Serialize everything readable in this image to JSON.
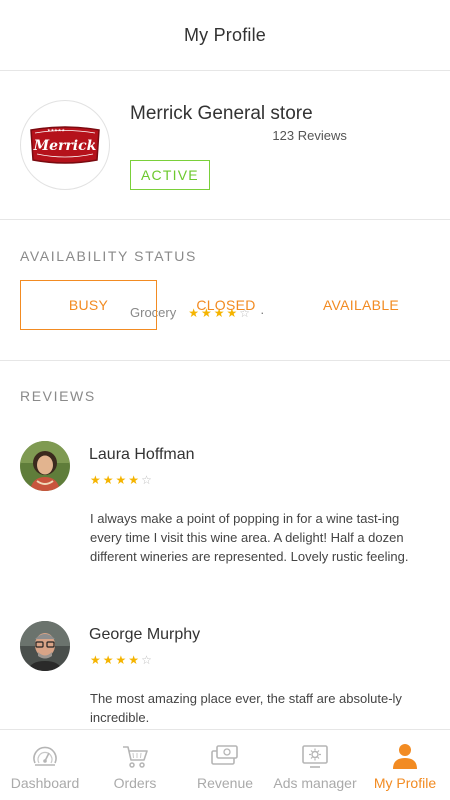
{
  "header": {
    "title": "My Profile"
  },
  "profile": {
    "store_name": "Merrick General store",
    "category": "Grocery",
    "rating": 4,
    "reviews_count": "123 Reviews",
    "status_badge": "ACTIVE",
    "logo_text": "Merrick"
  },
  "availability": {
    "title": "AVAILABILITY STATUS",
    "options": [
      "BUSY",
      "CLOSED",
      "AVAILABLE"
    ],
    "selected": "BUSY"
  },
  "reviews": {
    "title": "REVIEWS",
    "items": [
      {
        "name": "Laura Hoffman",
        "rating": 4,
        "text": "I always make a point of popping in for a wine tast-ing every time I visit this wine area.  A delight!  Half a dozen different wineries are represented.  Lovely rustic feeling."
      },
      {
        "name": "George Murphy",
        "rating": 4,
        "text": "The most amazing place ever, the staff are absolute-ly incredible."
      }
    ]
  },
  "tabbar": {
    "items": [
      {
        "label": "Dashboard",
        "icon": "dashboard-icon",
        "active": false
      },
      {
        "label": "Orders",
        "icon": "cart-icon",
        "active": false
      },
      {
        "label": "Revenue",
        "icon": "money-icon",
        "active": false
      },
      {
        "label": "Ads manager",
        "icon": "ads-icon",
        "active": false
      },
      {
        "label": "My Profile",
        "icon": "user-icon",
        "active": true
      }
    ]
  },
  "colors": {
    "accent": "#f28b22",
    "active_green": "#6cc92d",
    "star": "#f5b400",
    "logo_red": "#b5121b"
  }
}
